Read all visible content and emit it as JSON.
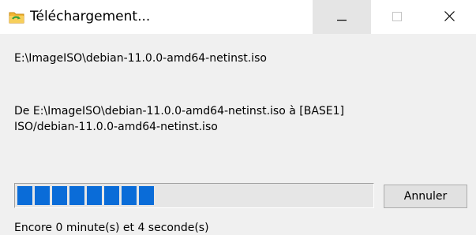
{
  "window": {
    "title": "Téléchargement...",
    "icon": "folder-transfer-icon",
    "controls": {
      "minimize_icon": "minimize-icon",
      "maximize_icon": "maximize-icon",
      "close_icon": "close-icon"
    }
  },
  "transfer": {
    "source_path": "E:\\ImageISO\\debian-11.0.0-amd64-netinst.iso",
    "detail_line1": "De E:\\ImageISO\\debian-11.0.0-amd64-netinst.iso à [BASE1]",
    "detail_line2": "ISO/debian-11.0.0-amd64-netinst.iso",
    "progress": {
      "filled_chunks": 8,
      "color": "#0a6cd8"
    },
    "time_remaining": "Encore 0 minute(s) et 4 seconde(s)"
  },
  "actions": {
    "cancel_label": "Annuler"
  }
}
